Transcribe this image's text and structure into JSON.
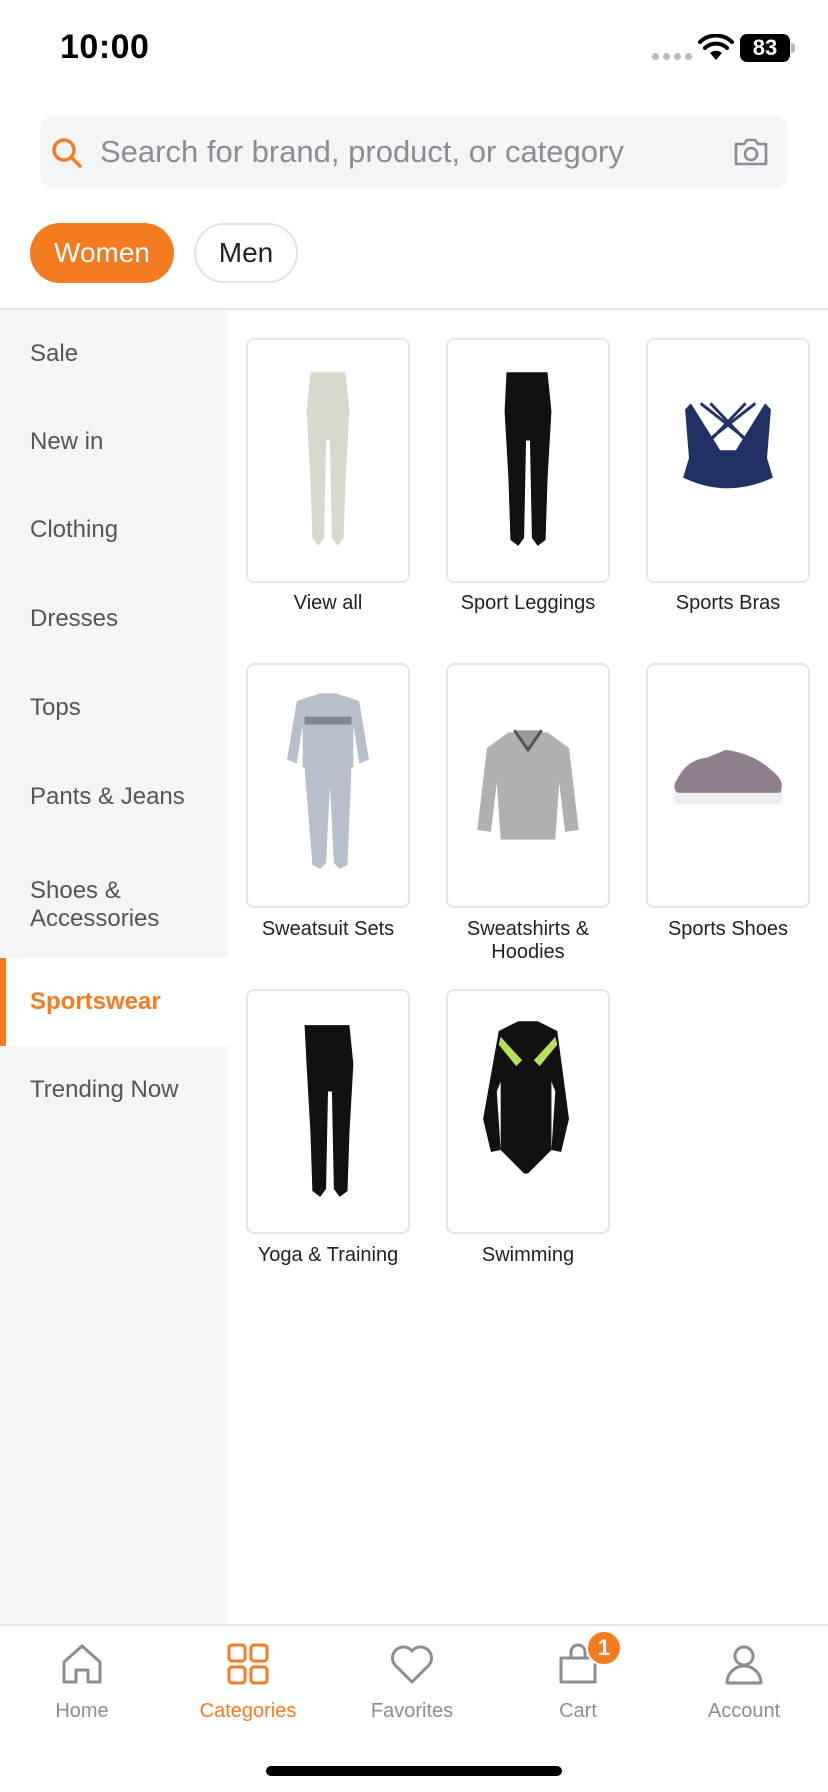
{
  "status_bar": {
    "time": "10:00",
    "battery": "83"
  },
  "search": {
    "placeholder": "Search for brand, product, or category"
  },
  "gender_tabs": [
    {
      "label": "Women",
      "active": true
    },
    {
      "label": "Men",
      "active": false
    }
  ],
  "sidebar": {
    "items": [
      {
        "label": "Sale"
      },
      {
        "label": "New in"
      },
      {
        "label": "Clothing"
      },
      {
        "label": "Dresses"
      },
      {
        "label": "Tops"
      },
      {
        "label": "Pants & Jeans"
      },
      {
        "label": "Shoes & Accessories"
      },
      {
        "label": "Sportswear",
        "active": true
      },
      {
        "label": "Trending Now"
      }
    ]
  },
  "categories": [
    {
      "label": "View all",
      "icon": "beige-leggings"
    },
    {
      "label": "Sport Leggings",
      "icon": "black-leggings"
    },
    {
      "label": "Sports Bras",
      "icon": "navy-sports-bra"
    },
    {
      "label": "Sweatsuit Sets",
      "icon": "grey-sweatsuit"
    },
    {
      "label": "Sweatshirts & Hoodies",
      "icon": "grey-hoodie"
    },
    {
      "label": "Sports Shoes",
      "icon": "mauve-sneaker"
    },
    {
      "label": "Yoga & Training",
      "icon": "black-leggings"
    },
    {
      "label": "Swimming",
      "icon": "black-swimsuit"
    }
  ],
  "bottom_nav": {
    "items": [
      {
        "label": "Home",
        "icon": "home-icon"
      },
      {
        "label": "Categories",
        "icon": "grid-icon",
        "active": true
      },
      {
        "label": "Favorites",
        "icon": "heart-icon"
      },
      {
        "label": "Cart",
        "icon": "cart-icon"
      },
      {
        "label": "Account",
        "icon": "person-icon"
      }
    ],
    "cart_badge": "1"
  },
  "colors": {
    "accent": "#f47b20",
    "sidebar_bg": "#f4f5f7",
    "muted_text": "#8a8d93"
  }
}
